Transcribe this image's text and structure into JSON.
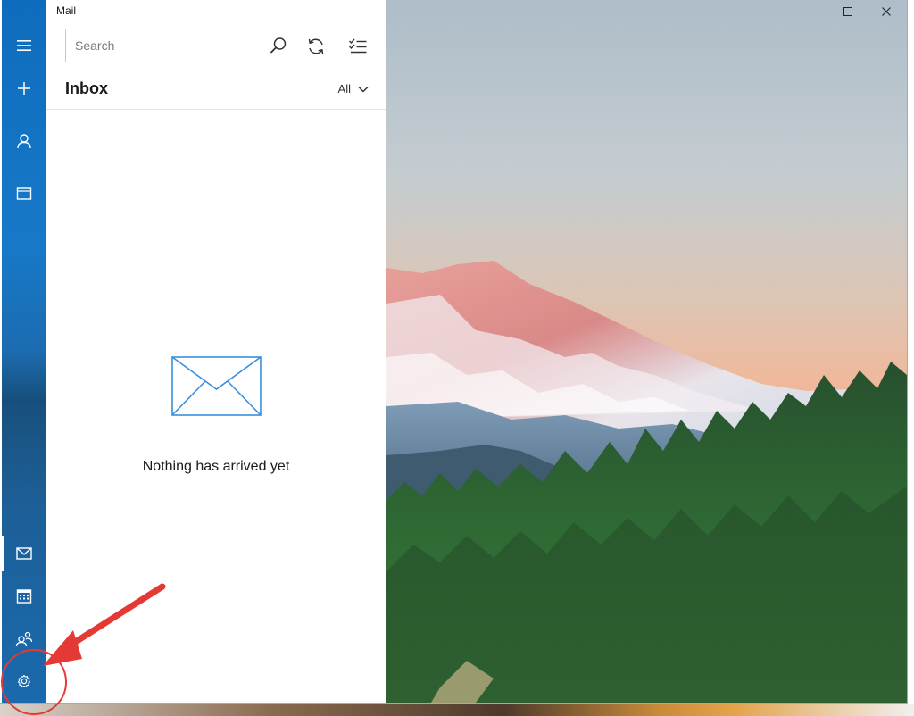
{
  "app": {
    "title": "Mail"
  },
  "search": {
    "placeholder": "Search"
  },
  "toolbar": {
    "sync": "sync-icon",
    "select": "select-mode-icon"
  },
  "inbox": {
    "title": "Inbox",
    "filter_label": "All",
    "empty_message": "Nothing has arrived yet"
  },
  "rail": {
    "top_items": [
      "hamburger-icon",
      "compose-icon",
      "account-icon",
      "folder-icon"
    ],
    "bottom_items": [
      "mail-icon",
      "calendar-icon",
      "people-icon",
      "settings-icon"
    ]
  },
  "window_controls": [
    "minimize-icon",
    "maximize-icon",
    "close-icon"
  ],
  "colors": {
    "rail": "#1679c8",
    "accent": "#0078d7",
    "annotation": "#e53935"
  }
}
